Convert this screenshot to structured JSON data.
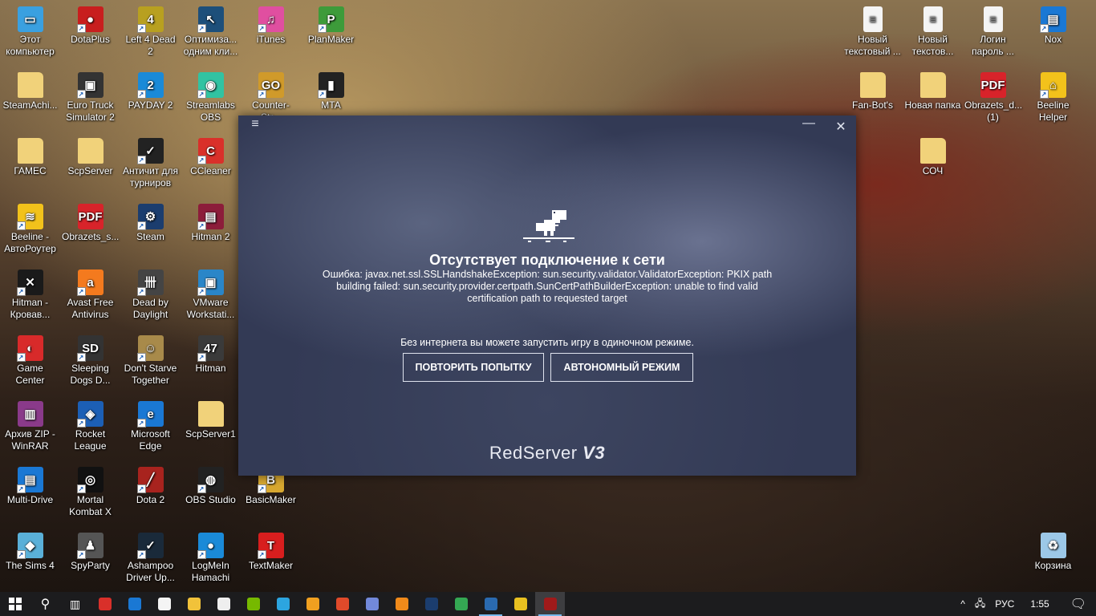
{
  "desktop_left": [
    {
      "label": "Этот компьютер",
      "color": "#3aa0e0",
      "glyph": "▭",
      "shortcut": false
    },
    {
      "label": "DotaPlus",
      "color": "#c81e1e",
      "glyph": "●",
      "shortcut": true
    },
    {
      "label": "Left 4 Dead 2",
      "color": "#b8a020",
      "glyph": "4",
      "shortcut": true
    },
    {
      "label": "Оптимиза... одним кли...",
      "color": "#1d4f7a",
      "glyph": "↖",
      "shortcut": true
    },
    {
      "label": "iTunes",
      "color": "#e04fa0",
      "glyph": "♫",
      "shortcut": true
    },
    {
      "label": "PlanMaker",
      "color": "#3d9b3a",
      "glyph": "P",
      "shortcut": true
    },
    {
      "label": "SteamAchi...",
      "color": "#f1d27a",
      "glyph": "",
      "shortcut": false
    },
    {
      "label": "Euro Truck Simulator 2",
      "color": "#333",
      "glyph": "▣",
      "shortcut": true
    },
    {
      "label": "PAYDAY 2",
      "color": "#1a8ad8",
      "glyph": "2",
      "shortcut": true
    },
    {
      "label": "Streamlabs OBS",
      "color": "#31c3a2",
      "glyph": "◉",
      "shortcut": true
    },
    {
      "label": "Counter-Str...",
      "color": "#d09a2a",
      "glyph": "GO",
      "shortcut": true
    },
    {
      "label": "MTA",
      "color": "#222",
      "glyph": "▮",
      "shortcut": true
    },
    {
      "label": "ГАМЕС",
      "color": "#f1d27a",
      "glyph": "",
      "shortcut": false
    },
    {
      "label": "ScpServer",
      "color": "#f1d27a",
      "glyph": "",
      "shortcut": false
    },
    {
      "label": "Античит для турниров",
      "color": "#222",
      "glyph": "✓",
      "shortcut": true
    },
    {
      "label": "CCleaner",
      "color": "#d9302a",
      "glyph": "C",
      "shortcut": true
    },
    {
      "label": "Beeline - АвтоРоутер",
      "color": "#f2c21b",
      "glyph": "≋",
      "shortcut": true
    },
    {
      "label": "Obrazets_s...",
      "color": "#d8232a",
      "glyph": "PDF",
      "shortcut": false
    },
    {
      "label": "Steam",
      "color": "#1b3d6e",
      "glyph": "⚙",
      "shortcut": true
    },
    {
      "label": "Hitman 2",
      "color": "#8c1d3a",
      "glyph": "▤",
      "shortcut": true
    },
    {
      "label": "Hitman - Кровав...",
      "color": "#1a1a1a",
      "glyph": "✕",
      "shortcut": true
    },
    {
      "label": "Avast Free Antivirus",
      "color": "#f47a1e",
      "glyph": "a",
      "shortcut": true
    },
    {
      "label": "Dead by Daylight",
      "color": "#444",
      "glyph": "卌",
      "shortcut": true
    },
    {
      "label": "VMware Workstati...",
      "color": "#2a86c8",
      "glyph": "▣",
      "shortcut": true
    },
    {
      "label": "Game Center",
      "color": "#d82a2a",
      "glyph": "◐",
      "shortcut": true
    },
    {
      "label": "Sleeping Dogs D...",
      "color": "#333",
      "glyph": "SD",
      "shortcut": true
    },
    {
      "label": "Don't Starve Together",
      "color": "#a88a4a",
      "glyph": "☺",
      "shortcut": true
    },
    {
      "label": "Hitman",
      "color": "#3a3a3a",
      "glyph": "47",
      "shortcut": true
    },
    {
      "label": "Архив ZIP - WinRAR",
      "color": "#8a3a8a",
      "glyph": "▥",
      "shortcut": false
    },
    {
      "label": "Rocket League",
      "color": "#1c5fb5",
      "glyph": "◈",
      "shortcut": true
    },
    {
      "label": "Microsoft Edge",
      "color": "#1a78d4",
      "glyph": "e",
      "shortcut": true
    },
    {
      "label": "ScpServer1",
      "color": "#f1d27a",
      "glyph": "",
      "shortcut": false
    },
    {
      "label": "Multi-Drive",
      "color": "#1a78d4",
      "glyph": "▤",
      "shortcut": true
    },
    {
      "label": "Mortal Kombat X",
      "color": "#111",
      "glyph": "◎",
      "shortcut": true
    },
    {
      "label": "Dota 2",
      "color": "#a8231e",
      "glyph": "╱",
      "shortcut": true
    },
    {
      "label": "OBS Studio",
      "color": "#222",
      "glyph": "◍",
      "shortcut": true
    },
    {
      "label": "BasicMaker",
      "color": "#d8a830",
      "glyph": "B",
      "shortcut": true
    },
    {
      "label": "The Sims 4",
      "color": "#5ab0d8",
      "glyph": "◆",
      "shortcut": true
    },
    {
      "label": "SpyParty",
      "color": "#555",
      "glyph": "♟",
      "shortcut": true
    },
    {
      "label": "Ashampoo Driver Up...",
      "color": "#1a2a3a",
      "glyph": "✓",
      "shortcut": true
    },
    {
      "label": "LogMeIn Hamachi",
      "color": "#1a8ad8",
      "glyph": "●",
      "shortcut": true
    },
    {
      "label": "TextMaker",
      "color": "#d81e1e",
      "glyph": "T",
      "shortcut": true
    }
  ],
  "desktop_right": [
    {
      "label": "Новый текстовый ...",
      "color": "#f4f4f4",
      "glyph": "≡",
      "shortcut": false
    },
    {
      "label": "Новый текстов...",
      "color": "#f4f4f4",
      "glyph": "≡",
      "shortcut": false
    },
    {
      "label": "Логин пароль ...",
      "color": "#f4f4f4",
      "glyph": "≡",
      "shortcut": false
    },
    {
      "label": "Nox",
      "color": "#1a78d4",
      "glyph": "▤",
      "shortcut": true
    },
    {
      "label": "Fan-Bot's",
      "color": "#f1d27a",
      "glyph": "",
      "shortcut": false
    },
    {
      "label": "Новая папка",
      "color": "#f1d27a",
      "glyph": "",
      "shortcut": false
    },
    {
      "label": "Obrazets_d... (1)",
      "color": "#d8232a",
      "glyph": "PDF",
      "shortcut": false
    },
    {
      "label": "Beeline Helper",
      "color": "#f2c21b",
      "glyph": "⌂",
      "shortcut": true
    },
    {
      "label": "СОЧ",
      "color": "#f1d27a",
      "glyph": "",
      "shortcut": false
    },
    {
      "label": "Корзина",
      "color": "#9cc8e8",
      "glyph": "♻",
      "shortcut": false
    }
  ],
  "dialog": {
    "menu_icon": "hamburger-icon",
    "minimize_icon": "minimize-icon",
    "close_icon": "close-icon",
    "title": "Отсутствует подключение к сети",
    "error": "Ошибка: javax.net.ssl.SSLHandshakeException: sun.security.validator.ValidatorException: PKIX path building failed: sun.security.provider.certpath.SunCertPathBuilderException: unable to find valid certification path to requested target",
    "offline_hint": "Без интернета вы можете запустить игру в одиночном режиме.",
    "retry_label": "ПОВТОРИТЬ ПОПЫТКУ",
    "offline_label": "АВТОНОМНЫЙ РЕЖИМ",
    "logo_main": "RedServer",
    "logo_version": "V3"
  },
  "taskbar": {
    "apps": [
      {
        "name": "ccleaner",
        "color": "#d9302a"
      },
      {
        "name": "edge",
        "color": "#1a78d4"
      },
      {
        "name": "store",
        "color": "#f4f4f4"
      },
      {
        "name": "file-explorer",
        "color": "#f1c23a"
      },
      {
        "name": "mail",
        "color": "#eee"
      },
      {
        "name": "nvidia",
        "color": "#76b900"
      },
      {
        "name": "telegram",
        "color": "#2ca5e0"
      },
      {
        "name": "media-player",
        "color": "#f0a020"
      },
      {
        "name": "rubik",
        "color": "#e04a2a"
      },
      {
        "name": "discord",
        "color": "#7289da"
      },
      {
        "name": "firefox",
        "color": "#f08a1a"
      },
      {
        "name": "steam",
        "color": "#1b3d6e"
      },
      {
        "name": "chrome",
        "color": "#34a853"
      },
      {
        "name": "teamspeak",
        "color": "#2a6ab0"
      },
      {
        "name": "game-center",
        "color": "#e8c020"
      },
      {
        "name": "redserver",
        "color": "#a01a1a"
      }
    ],
    "language": "РУС",
    "time": "1:55"
  }
}
